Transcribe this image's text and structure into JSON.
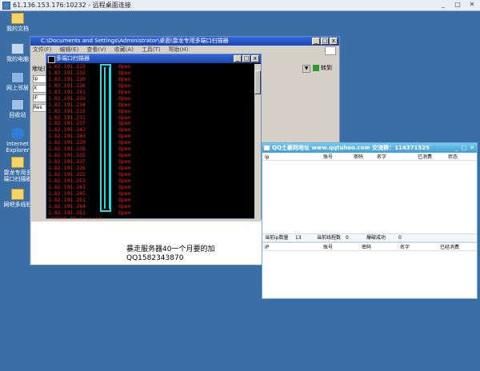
{
  "rdp": {
    "title": "61.136.153.176:10232 - 远程桌面连接",
    "min": "_",
    "max": "□",
    "close": "✕"
  },
  "desktop": [
    {
      "label": "我的文档",
      "icon": "folder-doc-icon",
      "color": "#f4d56a"
    },
    {
      "label": "我的电脑",
      "icon": "computer-icon",
      "color": "#c0d8f0"
    },
    {
      "label": "网上邻居",
      "icon": "network-icon",
      "color": "#8cb4e0"
    },
    {
      "label": "回收站",
      "icon": "recycle-bin-icon",
      "color": "#9ec0e4"
    },
    {
      "label": "Internet Explorer",
      "icon": "ie-icon",
      "color": "#2f7fd8"
    },
    {
      "label": "雷龙专用多端口扫描器",
      "icon": "folder-icon",
      "color": "#f4d56a"
    },
    {
      "label": "网吧多线程",
      "icon": "folder-icon",
      "color": "#f4d56a"
    }
  ],
  "explorer": {
    "title": "C:\\Documents and Settings\\Administrator\\桌面\\雷龙专用多端口扫描器",
    "menu": [
      "文件(F)",
      "编辑(E)",
      "查看(V)",
      "收藏(A)",
      "工具(T)",
      "帮助(H)"
    ],
    "address_label": "地址(D)",
    "go_label": "转到",
    "side_items": [
      "ip",
      "X",
      "iF",
      "Res"
    ]
  },
  "note": {
    "line1": "暴走服务器40一个月要的加",
    "line2": "QQ1582343870"
  },
  "console": {
    "title": "多端口扫描器",
    "rows": [
      [
        "1.82.191.223",
        "Open"
      ],
      [
        "1.82.191.232",
        "Open"
      ],
      [
        "1.82.191.230",
        "Open"
      ],
      [
        "1.82.191.236",
        "Open"
      ],
      [
        "1.82.191.241",
        "Open"
      ],
      [
        "1.82.191.239",
        "Open"
      ],
      [
        "1.82.191.234",
        "Open"
      ],
      [
        "1.82.191.233",
        "Open"
      ],
      [
        "1.82.191.231",
        "Open"
      ],
      [
        "1.82.191.237",
        "Open"
      ],
      [
        "1.82.191.242",
        "Open"
      ],
      [
        "1.82.191.240",
        "Open"
      ],
      [
        "1.82.191.229",
        "Open"
      ],
      [
        "1.82.191.238",
        "Open"
      ],
      [
        "1.82.191.235",
        "Open"
      ],
      [
        "1.82.191.227",
        "Open"
      ],
      [
        "1.82.191.226",
        "Open"
      ],
      [
        "1.82.191.222",
        "Open"
      ],
      [
        "1.82.191.253",
        "Open"
      ],
      [
        "1.82.191.243",
        "Open"
      ],
      [
        "1.82.191.245",
        "Open"
      ],
      [
        "1.82.191.251",
        "Open"
      ],
      [
        "1.82.191.244",
        "Open"
      ],
      [
        "1.82.191.252",
        "Open"
      ]
    ],
    "summary": "184000 IP Scanned."
  },
  "qq": {
    "title": "QQ土豪网地址  www.qqtuhao.com  交流群：114371525",
    "min": "_",
    "max": "□",
    "close": "✕",
    "top_headers": [
      "ip",
      "账号",
      "密码",
      "名字",
      "已消费",
      "状态"
    ],
    "stats": {
      "ip_label": "当前ip数量",
      "ip_value": "13",
      "thread_label": "当前线程数",
      "thread_value": "0",
      "success_label": "爆破成功",
      "success_value": "0"
    },
    "bottom_headers": [
      "IP",
      "账号",
      "密码",
      "名字",
      "已经消费"
    ]
  },
  "colors": {
    "desktop": "#3a6ea5",
    "console_text": "#ff2020",
    "highlight": "#18e0e8",
    "qq_title": "#3ea0d6"
  }
}
